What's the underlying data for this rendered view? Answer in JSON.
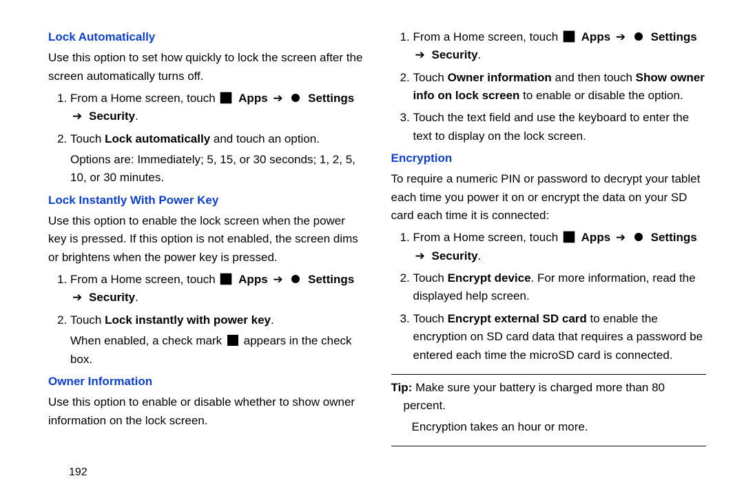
{
  "labels": {
    "apps": "Apps",
    "settings": "Settings",
    "security": "Security",
    "tipLabel": "Tip:"
  },
  "left": {
    "sec1": {
      "heading": "Lock Automatically",
      "intro": "Use this option to set how quickly to lock the screen after the screen automatically turns off.",
      "step1pre": "From a Home screen, touch ",
      "step2": {
        "pre": "Touch ",
        "bold": "Lock automatically",
        "post": " and touch an option."
      },
      "optionsLine": "Options are: Immediately; 5, 15, or 30 seconds; 1, 2, 5, 10, or 30 minutes."
    },
    "sec2": {
      "heading": "Lock Instantly With Power Key",
      "intro": "Use this option to enable the lock screen when the power key is pressed. If this option is not enabled, the screen dims or brightens when the power key is pressed.",
      "step1pre": "From a Home screen, touch ",
      "step2": {
        "pre": "Touch ",
        "bold": "Lock instantly with power key",
        "post": "."
      },
      "checkPre": "When enabled, a check mark ",
      "checkPost": " appears in the check box."
    },
    "sec3": {
      "heading": "Owner Information",
      "intro": "Use this option to enable or disable whether to show owner information on the lock screen."
    }
  },
  "right": {
    "ownerSteps": {
      "step1pre": "From a Home screen, touch ",
      "step2": {
        "pre": "Touch ",
        "b1": "Owner information",
        "mid": " and then touch ",
        "b2": "Show owner info on lock screen",
        "post": " to enable or disable the option."
      },
      "step3": "Touch the text field and use the keyboard to enter the text to display on the lock screen."
    },
    "sec4": {
      "heading": "Encryption",
      "intro": "To require a numeric PIN or password to decrypt your tablet each time you power it on or encrypt the data on your SD card each time it is connected:",
      "step1pre": "From a Home screen, touch ",
      "step2": {
        "pre": "Touch ",
        "bold": "Encrypt device",
        "post": ". For more information, read the displayed help screen."
      },
      "step3": {
        "pre": "Touch ",
        "bold": "Encrypt external SD card",
        "post": " to enable the encryption on SD card data that requires a password be entered each time the microSD card is connected."
      }
    },
    "tip": {
      "line1": "Make sure your battery is charged more than 80 percent.",
      "line2": "Encryption takes an hour or more."
    }
  },
  "pageNumber": "192"
}
